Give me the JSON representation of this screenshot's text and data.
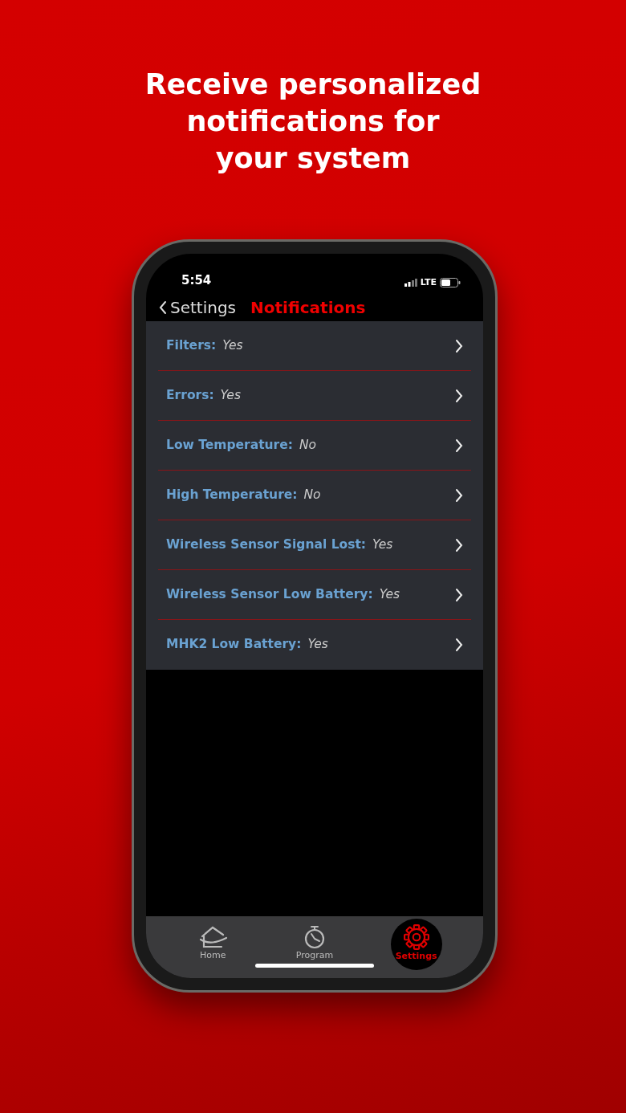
{
  "headline": "Receive personalized\nnotifications for\nyour system",
  "status_bar": {
    "time": "5:54",
    "network": "LTE"
  },
  "nav": {
    "back": "Settings",
    "title": "Notifications"
  },
  "settings": [
    {
      "label": "Filters:",
      "value": "Yes"
    },
    {
      "label": "Errors:",
      "value": "Yes"
    },
    {
      "label": "Low Temperature:",
      "value": "No"
    },
    {
      "label": "High Temperature:",
      "value": "No"
    },
    {
      "label": "Wireless Sensor Signal Lost:",
      "value": "Yes"
    },
    {
      "label": "Wireless Sensor Low Battery:",
      "value": "Yes"
    },
    {
      "label": "MHK2 Low Battery:",
      "value": "Yes"
    }
  ],
  "tabs": [
    {
      "kind": "home",
      "label": "Home",
      "selected": false
    },
    {
      "kind": "timer",
      "label": "Program",
      "selected": false
    },
    {
      "kind": "gear",
      "label": "Settings",
      "selected": true
    }
  ]
}
